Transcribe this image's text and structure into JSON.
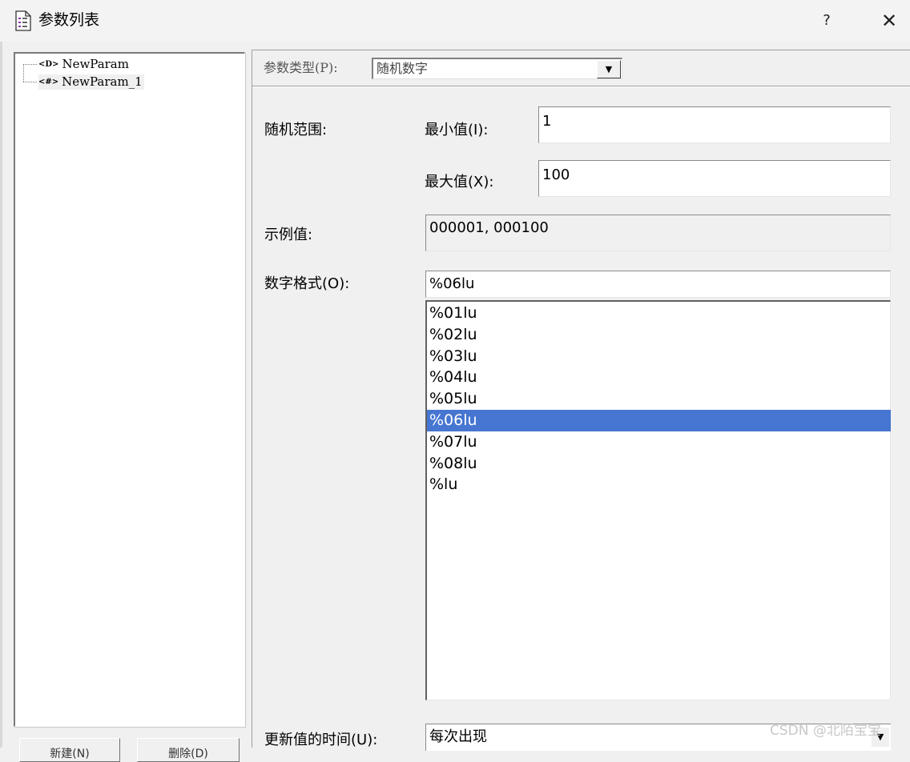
{
  "window": {
    "title": "参数列表",
    "help": "?",
    "close": "✕"
  },
  "tree": {
    "items": [
      {
        "icon": "<D>",
        "label": "NewParam"
      },
      {
        "icon": "<#>",
        "label": "NewParam_1"
      }
    ]
  },
  "buttons": {
    "new": "新建(N)",
    "delete": "删除(D)"
  },
  "param_type": {
    "label": "参数类型(P):",
    "value": "随机数字"
  },
  "range": {
    "label": "随机范围:",
    "min_label": "最小值(I):",
    "min_value": "1",
    "max_label": "最大值(X):",
    "max_value": "100"
  },
  "example": {
    "label": "示例值:",
    "value": "000001, 000100"
  },
  "format": {
    "label": "数字格式(O):",
    "value": "%06lu",
    "options": [
      "%01lu",
      "%02lu",
      "%03lu",
      "%04lu",
      "%05lu",
      "%06lu",
      "%07lu",
      "%08lu",
      "%lu"
    ],
    "selected_index": 5
  },
  "update": {
    "label": "更新值的时间(U):",
    "value": "每次出现"
  },
  "watermark": "CSDN @北陌宝宝",
  "colors": {
    "selection": "#4676d1",
    "background": "#f0f0f0"
  }
}
